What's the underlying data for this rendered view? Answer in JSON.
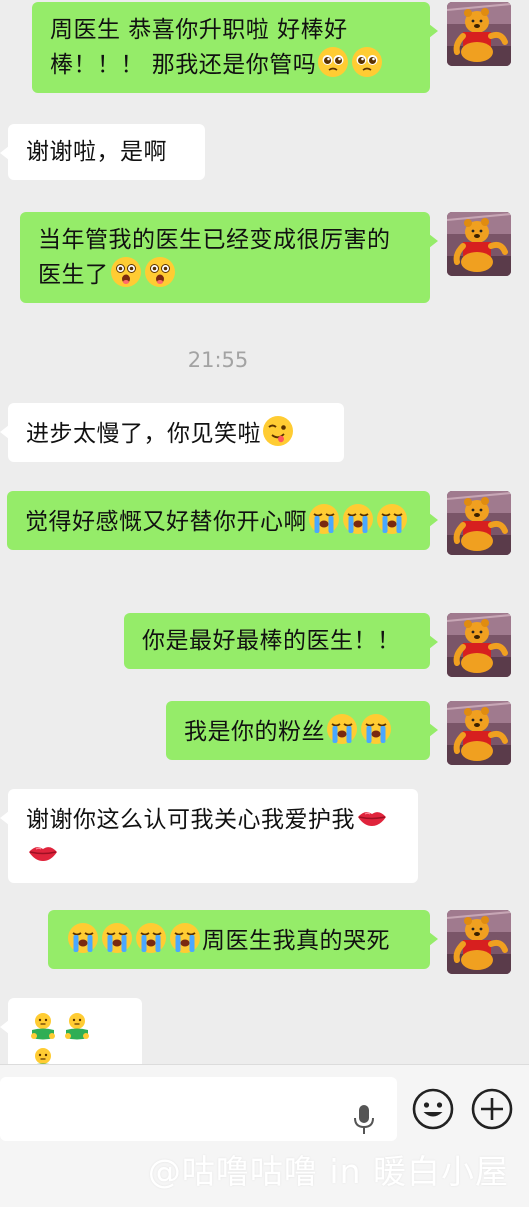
{
  "messages": [
    {
      "side": "out",
      "text": "周医生 恭喜你升职啦 好棒好棒！！！ 那我还是你管吗",
      "emojis": [
        "pleading-face-emoji",
        "pleading-face-emoji"
      ]
    },
    {
      "side": "in",
      "text": "谢谢啦，是啊",
      "emojis": []
    },
    {
      "side": "out",
      "text": "当年管我的医生已经变成很厉害的医生了",
      "emojis": [
        "astonished-face-emoji",
        "astonished-face-emoji"
      ]
    },
    {
      "side": "in",
      "text": "进步太慢了，你见笑啦",
      "emojis": [
        "winking-tongue-face-emoji"
      ]
    },
    {
      "side": "out",
      "text": "觉得好感慨又好替你开心啊",
      "emojis": [
        "loudly-crying-face-emoji",
        "loudly-crying-face-emoji",
        "loudly-crying-face-emoji"
      ]
    },
    {
      "side": "out",
      "text": "你是最好最棒的医生！！",
      "emojis": []
    },
    {
      "side": "out",
      "text": "我是你的粉丝",
      "emojis": [
        "loudly-crying-face-emoji",
        "loudly-crying-face-emoji"
      ]
    },
    {
      "side": "in",
      "text": "谢谢你这么认可我关心我爱护我",
      "emojis": [
        "lips-emoji",
        "lips-emoji"
      ]
    },
    {
      "side": "out",
      "text": "周医生我真的哭死",
      "emojis": [
        "loudly-crying-face-emoji",
        "loudly-crying-face-emoji",
        "loudly-crying-face-emoji",
        "loudly-crying-face-emoji"
      ],
      "emojis_first": true
    },
    {
      "side": "in",
      "text": "",
      "emojis": [
        "bowing-figure-emoji",
        "bowing-figure-emoji",
        "bowing-figure-emoji"
      ]
    }
  ],
  "timestamp": "21:55",
  "input_bar": {
    "voice_icon": "microphone-icon",
    "emoji_icon": "smiley-face-icon",
    "plus_icon": "plus-circle-icon"
  },
  "watermark": "@咕噜咕噜 in 暖白小屋",
  "colors": {
    "background": "#ededed",
    "outgoing_bubble": "#95ec69",
    "incoming_bubble": "#ffffff",
    "timestamp_text": "#a3a3a3",
    "input_bar": "#f5f5f5"
  }
}
